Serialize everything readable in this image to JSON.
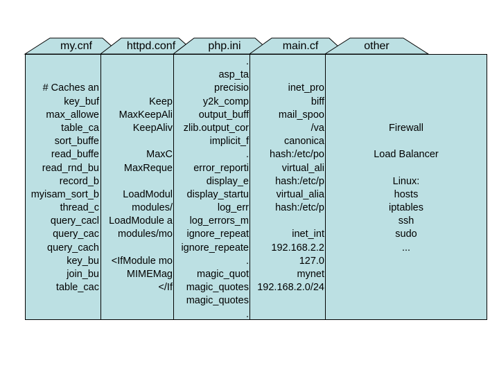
{
  "colors": {
    "panel_fill": "#bce0e3",
    "border": "#000000",
    "background": "#ffffff"
  },
  "tabs": [
    {
      "id": "mycnf",
      "label": "my.cnf",
      "lines": [
        "",
        "",
        "# Caches an",
        "key_buf",
        "max_allowe",
        "table_ca",
        "sort_buffe",
        "read_buffe",
        "read_rnd_bu",
        "record_b",
        "myisam_sort_b",
        "thread_c",
        "query_cacl",
        "query_cac",
        "query_cach",
        "key_bu",
        "join_bu",
        "table_cac"
      ]
    },
    {
      "id": "httpdconf",
      "label": "httpd.conf",
      "lines": [
        "",
        "",
        "",
        "Keep",
        "MaxKeepAli",
        "KeepAliv",
        "",
        "MaxC",
        "MaxReque",
        "",
        "LoadModul",
        "modules/",
        "LoadModule a",
        "modules/mo",
        "",
        "<IfModule mo",
        "MIMEMag",
        "</If"
      ]
    },
    {
      "id": "phpini",
      "label": "php.ini",
      "lines": [
        ".",
        "asp_ta",
        "precisio",
        "y2k_comp",
        "output_buff",
        "zlib.output_cor",
        "implicit_f",
        ".",
        "error_reporti",
        "display_e",
        "display_startu",
        "log_err",
        "log_errors_m",
        "ignore_repeat",
        "ignore_repeate",
        ".",
        "magic_quot",
        "magic_quotes",
        "magic_quotes",
        "."
      ]
    },
    {
      "id": "maincf",
      "label": "main.cf",
      "lines": [
        "",
        "",
        "inet_pro",
        "biff",
        "mail_spoo",
        "/va",
        "canonica",
        "hash:/etc/po",
        "virtual_ali",
        "hash:/etc/p",
        "virtual_alia",
        "hash:/etc/p",
        "",
        "inet_int",
        "192.168.2.2",
        "127.0",
        "mynet",
        "192.168.2.0/24"
      ]
    },
    {
      "id": "other",
      "label": "other",
      "lines": [
        "",
        "",
        "",
        "",
        "",
        "Firewall",
        "",
        "Load Balancer",
        "",
        "Linux:",
        "hosts",
        "iptables",
        "ssh",
        "sudo",
        "..."
      ]
    }
  ]
}
